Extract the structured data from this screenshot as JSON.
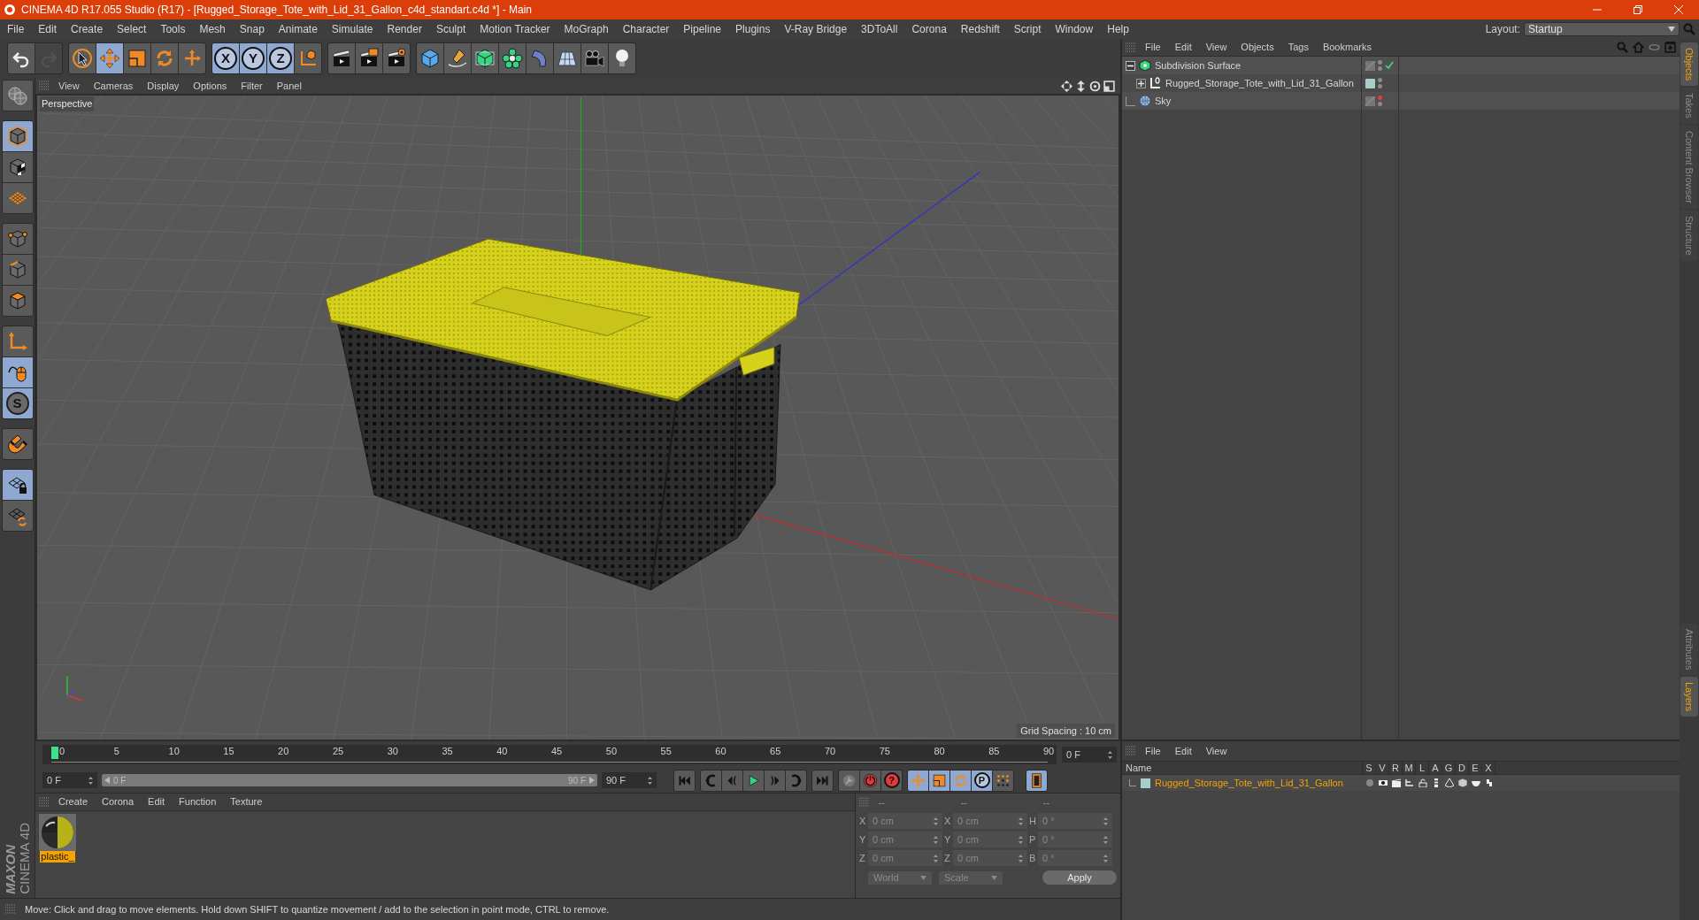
{
  "window": {
    "title": "CINEMA 4D R17.055 Studio (R17) - [Rugged_Storage_Tote_with_Lid_31_Gallon_c4d_standart.c4d *] - Main"
  },
  "menu": [
    "File",
    "Edit",
    "Create",
    "Select",
    "Tools",
    "Mesh",
    "Snap",
    "Animate",
    "Simulate",
    "Render",
    "Sculpt",
    "Motion Tracker",
    "MoGraph",
    "Character",
    "Pipeline",
    "Plugins",
    "V-Ray Bridge",
    "3DToAll",
    "Corona",
    "Redshift",
    "Script",
    "Window",
    "Help"
  ],
  "layout": {
    "label": "Layout:",
    "value": "Startup"
  },
  "toolbar": [
    [
      {
        "kind": "undo",
        "selected": false,
        "disabled": false
      },
      {
        "kind": "redo",
        "selected": false,
        "disabled": true
      }
    ],
    [
      {
        "kind": "select",
        "selected": false,
        "disabled": false
      },
      {
        "kind": "move",
        "selected": true,
        "disabled": false
      },
      {
        "kind": "scale",
        "selected": false,
        "disabled": false
      },
      {
        "kind": "rotate",
        "selected": false,
        "disabled": false
      },
      {
        "kind": "transform",
        "selected": false,
        "disabled": false
      }
    ],
    [
      {
        "kind": "axis",
        "label": "X",
        "selected": true,
        "disabled": false
      },
      {
        "kind": "axis",
        "label": "Y",
        "selected": true,
        "disabled": false
      },
      {
        "kind": "axis",
        "label": "Z",
        "selected": true,
        "disabled": false
      },
      {
        "kind": "coords",
        "selected": false,
        "disabled": false
      }
    ],
    [
      {
        "kind": "render-view",
        "selected": false,
        "disabled": false
      },
      {
        "kind": "render-picture",
        "selected": false,
        "disabled": false
      },
      {
        "kind": "render-settings",
        "selected": false,
        "disabled": false
      }
    ],
    [
      {
        "kind": "cube",
        "selected": false,
        "disabled": false
      },
      {
        "kind": "pen",
        "selected": false,
        "disabled": false
      },
      {
        "kind": "subdivision",
        "selected": false,
        "disabled": false
      },
      {
        "kind": "cloner",
        "selected": false,
        "disabled": false
      },
      {
        "kind": "deformer",
        "selected": false,
        "disabled": false
      },
      {
        "kind": "floor",
        "selected": false,
        "disabled": false
      },
      {
        "kind": "camera",
        "selected": false,
        "disabled": false
      },
      {
        "kind": "light",
        "selected": false,
        "disabled": false
      }
    ]
  ],
  "left_tools": [
    [
      {
        "kind": "make-editable",
        "selected": false
      }
    ],
    [
      {
        "kind": "model",
        "selected": true
      },
      {
        "kind": "texture",
        "selected": false
      },
      {
        "kind": "workplane",
        "selected": false
      }
    ],
    [
      {
        "kind": "points",
        "selected": false
      },
      {
        "kind": "edges",
        "selected": false
      },
      {
        "kind": "polygons",
        "selected": false
      }
    ],
    [
      {
        "kind": "axis-mode",
        "selected": false
      },
      {
        "kind": "tweak",
        "selected": true
      },
      {
        "kind": "snap",
        "label": "S",
        "selected": true
      }
    ],
    [
      {
        "kind": "magnet",
        "selected": false
      }
    ],
    [
      {
        "kind": "workplane-lock",
        "selected": true
      },
      {
        "kind": "workplane-align",
        "selected": false
      }
    ]
  ],
  "logo": {
    "brand": "MAXON",
    "product": "CINEMA 4D"
  },
  "viewport": {
    "menu": [
      "View",
      "Cameras",
      "Display",
      "Options",
      "Filter",
      "Panel"
    ],
    "camera": "Perspective",
    "grid_spacing": "Grid Spacing : 10 cm"
  },
  "timeline": {
    "ticks": [
      "0",
      "5",
      "10",
      "15",
      "20",
      "25",
      "30",
      "35",
      "40",
      "45",
      "50",
      "55",
      "60",
      "65",
      "70",
      "75",
      "80",
      "85",
      "90"
    ],
    "level": 0,
    "frame": "0 F"
  },
  "transport": {
    "start": "0 F",
    "range_start": "0 F",
    "range_end": "90 F",
    "level": 1,
    "end": "90 F",
    "groups": [
      [
        {
          "kind": "first",
          "selected": false
        }
      ],
      [
        {
          "kind": "prev-key",
          "selected": false
        },
        {
          "kind": "prev-frame",
          "selected": false
        },
        {
          "kind": "play",
          "selected": false
        },
        {
          "kind": "next-frame",
          "selected": false
        },
        {
          "kind": "next-key",
          "selected": false
        }
      ],
      [
        {
          "kind": "last",
          "selected": false
        }
      ],
      [
        {
          "kind": "keyframe",
          "selected": false
        },
        {
          "kind": "autokey",
          "selected": false
        },
        {
          "kind": "help",
          "label": "?",
          "selected": false
        }
      ],
      [
        {
          "kind": "key-move",
          "selected": true
        },
        {
          "kind": "key-scale",
          "selected": true
        },
        {
          "kind": "key-rotate",
          "selected": true
        },
        {
          "kind": "key-param",
          "label": "P",
          "selected": true
        },
        {
          "kind": "key-points",
          "selected": false
        }
      ],
      [
        {
          "kind": "film",
          "selected": true
        }
      ]
    ]
  },
  "materials": {
    "menu": [
      "Create",
      "Corona",
      "Edit",
      "Function",
      "Texture"
    ],
    "items": [
      {
        "name": "plastic_",
        "selected": true
      }
    ]
  },
  "coordinates": {
    "headers": [
      "--",
      "--",
      "--"
    ],
    "rows": [
      [
        {
          "axis": "X",
          "value": "0 cm"
        },
        {
          "axis": "X",
          "value": "0 cm"
        },
        {
          "axis": "H",
          "value": "0 °"
        }
      ],
      [
        {
          "axis": "Y",
          "value": "0 cm"
        },
        {
          "axis": "Y",
          "value": "0 cm"
        },
        {
          "axis": "P",
          "value": "0 °"
        }
      ],
      [
        {
          "axis": "Z",
          "value": "0 cm"
        },
        {
          "axis": "Z",
          "value": "0 cm"
        },
        {
          "axis": "B",
          "value": "0 °"
        }
      ]
    ],
    "dropdowns": [
      "World",
      "Scale"
    ],
    "apply": "Apply"
  },
  "objects": {
    "menu": [
      "File",
      "Edit",
      "View",
      "Objects",
      "Tags",
      "Bookmarks"
    ],
    "tree": [
      {
        "name": "Subdivision Surface",
        "kind": "subdivision",
        "expanded": true,
        "checked": true,
        "editor_visible": true,
        "children": [
          {
            "name": "Rugged_Storage_Tote_with_Lid_31_Gallon",
            "kind": "null",
            "expanded": false,
            "checked": false,
            "editor_visible": true,
            "color": "#a8cdca"
          }
        ]
      },
      {
        "name": "Sky",
        "kind": "sky",
        "checked": false,
        "editor_visible": false
      }
    ]
  },
  "layers": {
    "menu": [
      "File",
      "Edit",
      "View"
    ],
    "columns": [
      "Name",
      "S",
      "V",
      "R",
      "M",
      "L",
      "A",
      "G",
      "D",
      "E",
      "X"
    ],
    "rows": [
      {
        "name": "Rugged_Storage_Tote_with_Lid_31_Gallon",
        "color": "#a8cdca"
      }
    ]
  },
  "side_tabs_top": [
    {
      "label": "Objects",
      "selected": true
    },
    {
      "label": "Takes",
      "selected": false
    },
    {
      "label": "Content Browser",
      "selected": false
    },
    {
      "label": "Structure",
      "selected": false
    }
  ],
  "side_tabs_bottom": [
    {
      "label": "Attributes",
      "selected": false
    },
    {
      "label": "Layers",
      "selected": true
    }
  ],
  "status_bar": "Move: Click and drag to move elements. Hold down SHIFT to quantize movement / add to the selection in point mode, CTRL to remove."
}
